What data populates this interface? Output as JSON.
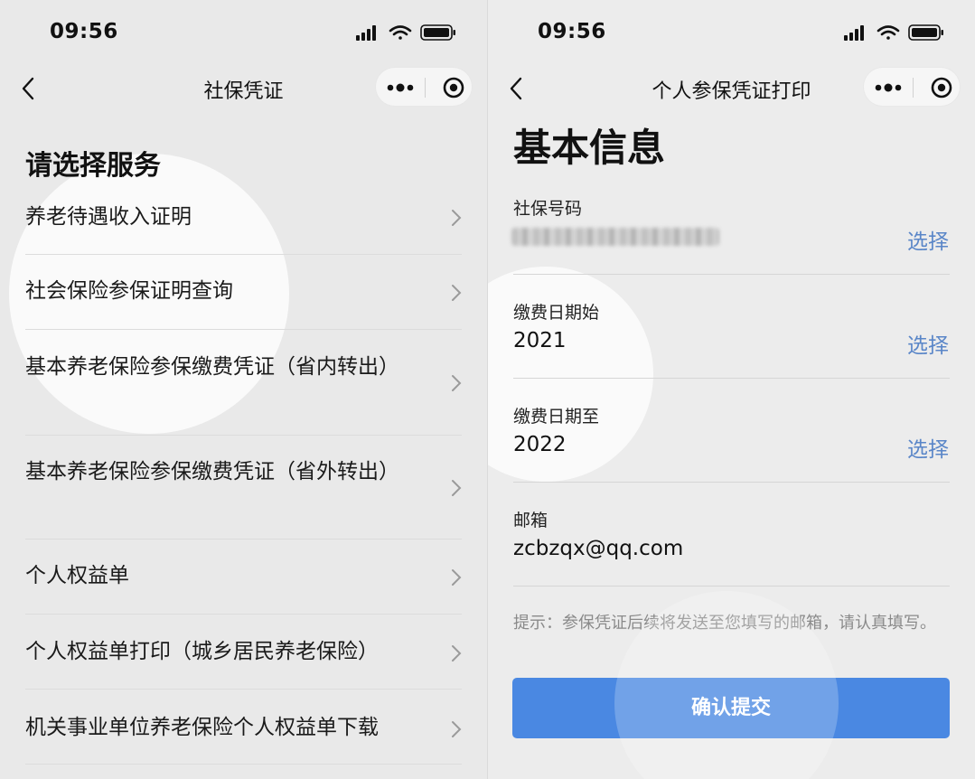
{
  "left": {
    "status": {
      "time": "09:56"
    },
    "nav": {
      "title": "社保凭证"
    },
    "section_title": "请选择服务",
    "items": [
      {
        "label": "养老待遇收入证明"
      },
      {
        "label": "社会保险参保证明查询"
      },
      {
        "label": "基本养老保险参保缴费凭证（省内转出）"
      },
      {
        "label": "基本养老保险参保缴费凭证（省外转出）"
      },
      {
        "label": "个人权益单"
      },
      {
        "label": "个人权益单打印（城乡居民养老保险）"
      },
      {
        "label": "机关事业单位养老保险个人权益单下载"
      }
    ]
  },
  "right": {
    "status": {
      "time": "09:56"
    },
    "nav": {
      "title": "个人参保凭证打印"
    },
    "page_title": "基本信息",
    "fields": {
      "ssn": {
        "label": "社保号码",
        "select": "选择"
      },
      "start": {
        "label": "缴费日期始",
        "value": "2021",
        "select": "选择"
      },
      "end": {
        "label": "缴费日期至",
        "value": "2022",
        "select": "选择"
      },
      "email": {
        "label": "邮箱",
        "value": "zcbzqx@qq.com"
      }
    },
    "hint": "提示：参保凭证后续将发送至您填写的邮箱，请认真填写。",
    "submit_label": "确认提交"
  },
  "colors": {
    "accent_blue": "#4a88e2",
    "link_blue": "#5a86c8"
  },
  "icons": [
    "back-chevron-icon",
    "more-dots-icon",
    "close-target-icon",
    "signal-icon",
    "wifi-icon",
    "battery-icon",
    "chevron-right-icon"
  ]
}
